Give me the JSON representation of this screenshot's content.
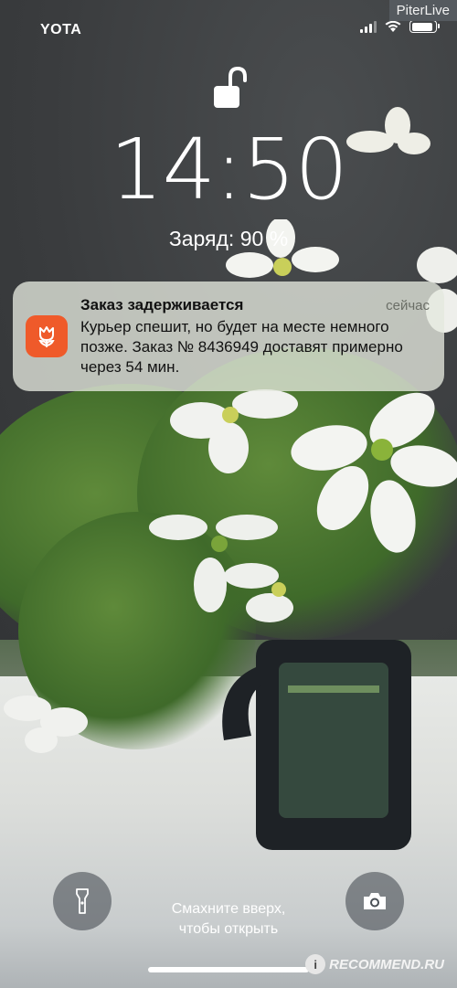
{
  "status_bar": {
    "carrier": "YOTA",
    "icons": [
      "signal-icon",
      "wifi-icon",
      "battery-icon"
    ]
  },
  "watermark_top": "PiterLive",
  "lock_screen": {
    "lock_icon": "unlocked-padlock-icon",
    "time": "14:50",
    "charge": "Заряд: 90 %"
  },
  "notification": {
    "app_icon": "tulip-icon",
    "app_color": "#ef5a2a",
    "title": "Заказ задерживается",
    "time": "сейчас",
    "body": "Курьер спешит, но будет на месте немного позже. Заказ № 8436949 доставят примерно через 54 мин."
  },
  "bottom": {
    "flashlight_icon": "flashlight-icon",
    "camera_icon": "camera-icon",
    "swipe_hint_line1": "Смахните вверх,",
    "swipe_hint_line2": "чтобы открыть"
  },
  "watermark_bottom": "RECOMMEND.RU"
}
